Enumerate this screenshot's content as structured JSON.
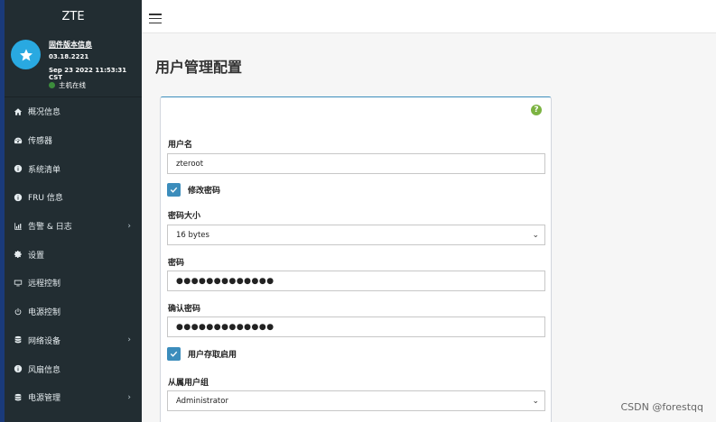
{
  "sidebar": {
    "brand": "ZTE",
    "user_panel": {
      "firmware_link": "固件版本信息",
      "firmware_version": "03.18.2221",
      "build_date": "Sep 23 2022 11:53:31 CST",
      "host_status": "主机在线"
    },
    "items": [
      {
        "label": "概况信息",
        "icon": "home-icon"
      },
      {
        "label": "传感器",
        "icon": "dashboard-icon"
      },
      {
        "label": "系统清单",
        "icon": "info-icon"
      },
      {
        "label": "FRU 信息",
        "icon": "info-icon"
      },
      {
        "label": "告警 & 日志",
        "icon": "bar-chart-icon"
      },
      {
        "label": "设置",
        "icon": "gear-icon"
      },
      {
        "label": "远程控制",
        "icon": "monitor-icon"
      },
      {
        "label": "电源控制",
        "icon": "power-icon"
      },
      {
        "label": "网络设备",
        "icon": "database-icon"
      },
      {
        "label": "风扇信息",
        "icon": "info-icon"
      },
      {
        "label": "电源管理",
        "icon": "database-icon"
      }
    ]
  },
  "main": {
    "title": "用户管理配置",
    "form": {
      "username_label": "用户名",
      "username_value": "zteroot",
      "change_password_label": "修改密码",
      "password_size_label": "密码大小",
      "password_size_value": "16 bytes",
      "password_label": "密码",
      "password_value": "●●●●●●●●●●●●●",
      "confirm_password_label": "确认密码",
      "confirm_password_value": "●●●●●●●●●●●●●",
      "user_access_label": "用户存取启用",
      "user_group_label": "从属用户组",
      "user_group_value": "Administrator"
    }
  },
  "watermark": "CSDN @forestqq",
  "colors": {
    "sidebar_bg": "#222d32",
    "accent": "#3c8dbc",
    "avatar": "#29a9e1",
    "help": "#7cb342",
    "status_online": "#3c8d3c"
  }
}
